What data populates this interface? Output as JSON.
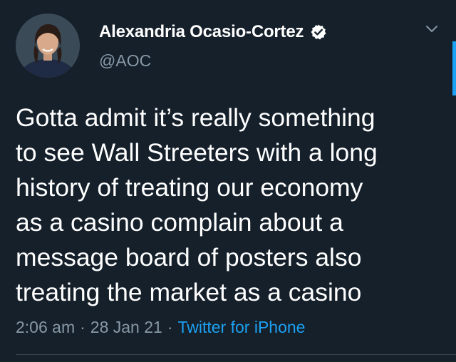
{
  "tweet": {
    "author": {
      "display_name": "Alexandria Ocasio-Cortez",
      "handle": "@AOC",
      "verified": true,
      "avatar_icon": "profile-photo"
    },
    "text_lines": [
      "Gotta admit it’s really something",
      "to see Wall Streeters with a long",
      "history of treating our economy",
      "as a casino complain about a",
      "message board of posters also",
      "treating the market as a casino"
    ],
    "time": "2:06 am",
    "separator": "·",
    "date": "28 Jan 21",
    "source": "Twitter for iPhone"
  },
  "colors": {
    "background": "#15202b",
    "text": "#ffffff",
    "secondary_text": "#8899a6",
    "accent": "#1da1f2",
    "divider": "#38444d"
  }
}
